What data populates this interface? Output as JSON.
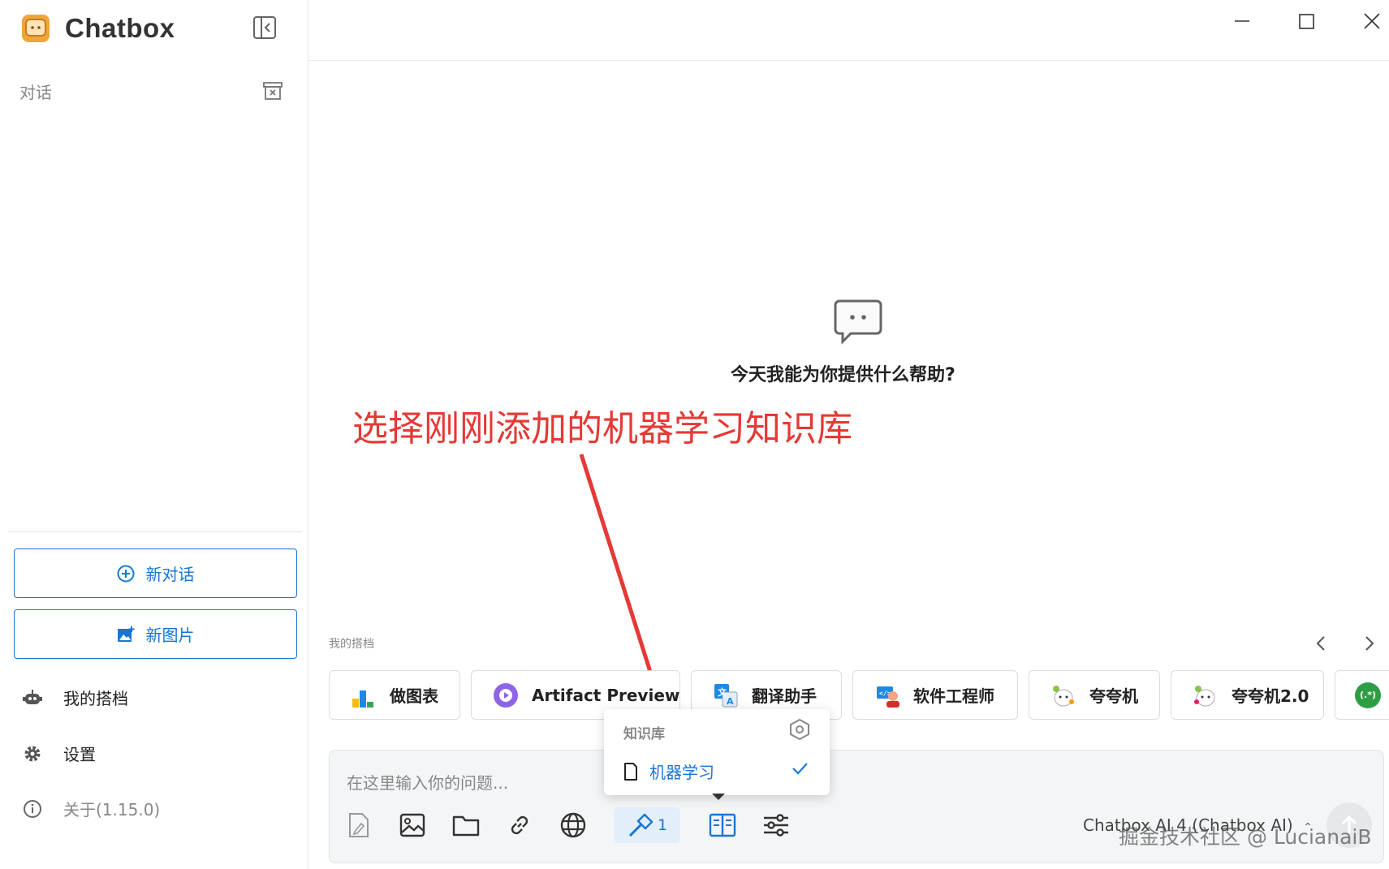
{
  "sidebar": {
    "app_name": "Chatbox",
    "conversations_label": "对话",
    "new_chat_label": "新对话",
    "new_image_label": "新图片",
    "my_partners_label": "我的搭档",
    "settings_label": "设置",
    "about_label": "关于(1.15.0)"
  },
  "main": {
    "empty_title": "今天我能为你提供什么帮助?",
    "annotation": "选择刚刚添加的机器学习知识库",
    "partners_label": "我的搭档",
    "partners": [
      {
        "label": "做图表",
        "icon": "bar-chart-icon"
      },
      {
        "label": "Artifact Preview",
        "icon": "play-circle-icon"
      },
      {
        "label": "翻译助手",
        "icon": "translate-icon"
      },
      {
        "label": "软件工程师",
        "icon": "engineer-avatar-icon"
      },
      {
        "label": "夸夸机",
        "icon": "cat-avatar-icon"
      },
      {
        "label": "夸夸机2.0",
        "icon": "cat-avatar-icon"
      },
      {
        "label": "(.*)",
        "icon": "regex-icon"
      }
    ]
  },
  "input": {
    "placeholder": "在这里输入你的问题...",
    "tools_count": "1",
    "model": "Chatbox AI 4 (Chatbox AI)"
  },
  "knowledge_menu": {
    "title": "知识库",
    "item": "机器学习"
  },
  "watermark": "掘金技术社区 @ LucianaiB",
  "colors": {
    "accent": "#1976d2",
    "annotation": "#e53935",
    "logo": "#f0a53c"
  }
}
